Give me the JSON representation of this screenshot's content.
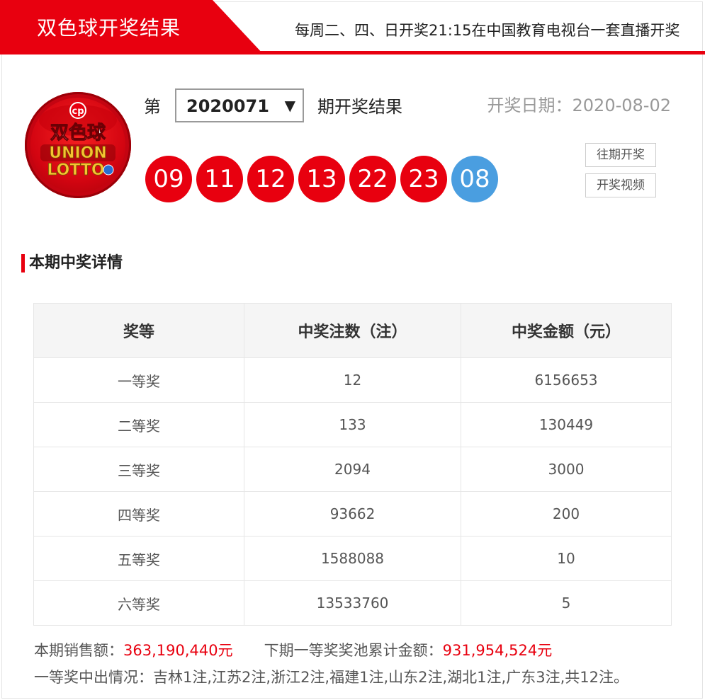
{
  "header": {
    "title": "双色球开奖结果",
    "note": "每周二、四、日开奖21:15在中国教育电视台一套直播开奖"
  },
  "logo": {
    "line1": "双色球",
    "line2": "UNION",
    "line3": "LOTTO"
  },
  "period": {
    "prefix": "第",
    "value": "2020071",
    "arrow": "▼",
    "suffix": "期开奖结果"
  },
  "draw_date": "开奖日期：2020-08-02",
  "balls": {
    "red": [
      "09",
      "11",
      "12",
      "13",
      "22",
      "23"
    ],
    "blue": "08"
  },
  "buttons": {
    "history": "往期开奖",
    "video": "开奖视频"
  },
  "section_title": "本期中奖详情",
  "table": {
    "headers": [
      "奖等",
      "中奖注数（注）",
      "中奖金额（元）"
    ],
    "rows": [
      [
        "一等奖",
        "12",
        "6156653"
      ],
      [
        "二等奖",
        "133",
        "130449"
      ],
      [
        "三等奖",
        "2094",
        "3000"
      ],
      [
        "四等奖",
        "93662",
        "200"
      ],
      [
        "五等奖",
        "1588088",
        "10"
      ],
      [
        "六等奖",
        "13533760",
        "5"
      ]
    ]
  },
  "footer": {
    "sales_label": "本期销售额：",
    "sales_value": "363,190,440元",
    "pool_label": "下期一等奖奖池累计金额：",
    "pool_value": "931,954,524元",
    "winners": "一等奖中出情况：吉林1注,江苏2注,浙江2注,福建1注,山东2注,湖北1注,广东3注,共12注。"
  },
  "colors": {
    "brand_red": "#e8000f",
    "blue_ball": "#4a9ee0"
  }
}
